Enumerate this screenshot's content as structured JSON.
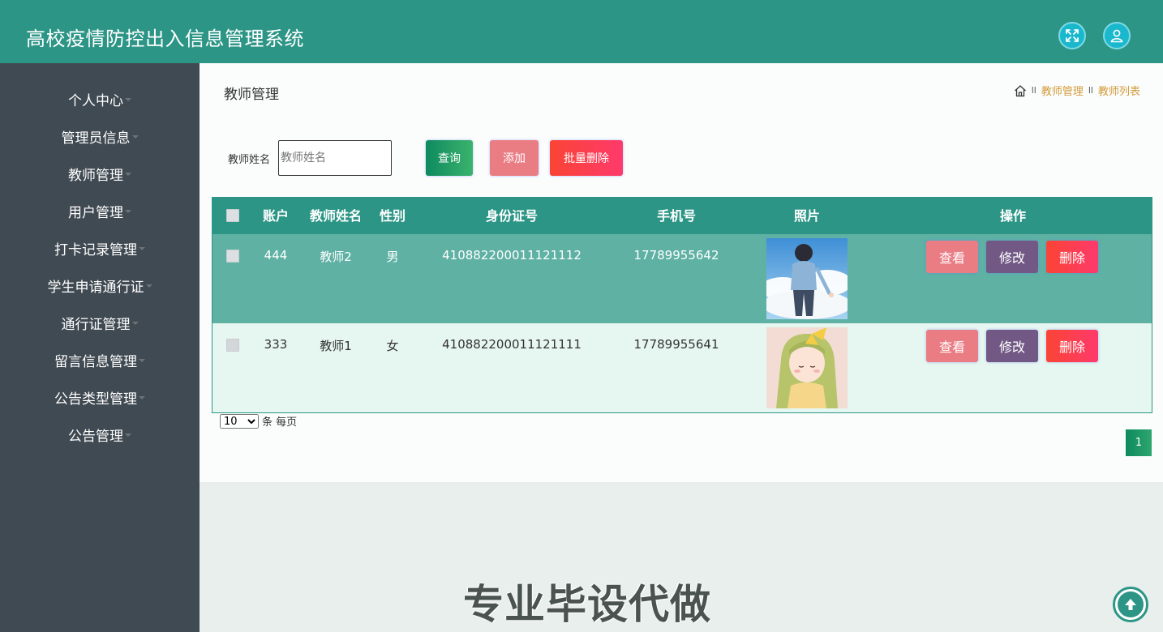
{
  "header": {
    "title": "高校疫情防控出入信息管理系统"
  },
  "sidebar": {
    "items": [
      {
        "label": "个人中心"
      },
      {
        "label": "管理员信息"
      },
      {
        "label": "教师管理"
      },
      {
        "label": "用户管理"
      },
      {
        "label": "打卡记录管理"
      },
      {
        "label": "学生申请通行证"
      },
      {
        "label": "通行证管理"
      },
      {
        "label": "留言信息管理"
      },
      {
        "label": "公告类型管理"
      },
      {
        "label": "公告管理"
      }
    ]
  },
  "main": {
    "page_title": "教师管理",
    "breadcrumb": {
      "sep": "ll",
      "items": [
        "教师管理",
        "教师列表"
      ]
    },
    "search": {
      "label": "教师姓名",
      "placeholder": "教师姓名",
      "value": ""
    },
    "buttons": {
      "query": "查询",
      "add": "添加",
      "batch_delete": "批量删除"
    },
    "table": {
      "columns": [
        "账户",
        "教师姓名",
        "性别",
        "身份证号",
        "手机号",
        "照片",
        "操作"
      ],
      "rows": [
        {
          "account": "444",
          "name": "教师2",
          "gender": "男",
          "id_number": "410882200011121112",
          "phone": "17789955642"
        },
        {
          "account": "333",
          "name": "教师1",
          "gender": "女",
          "id_number": "410882200011121111",
          "phone": "17789955641"
        }
      ],
      "actions": {
        "view": "查看",
        "edit": "修改",
        "delete": "删除"
      }
    },
    "pagination": {
      "page_size": "10",
      "page_size_suffix": "条 每页",
      "current_page": "1"
    }
  },
  "watermark": "专业毕设代做",
  "colors": {
    "primary": "#2c9586",
    "sidebar": "#404a52",
    "row_highlight": "#5fb1a4",
    "row_alt": "#e6f6f0",
    "view_button": "#ea7c84",
    "edit_button": "#725985",
    "delete_button": "#fa4434",
    "breadcrumb_link": "#d39a3a"
  },
  "icons": {
    "fullscreen": "expand-arrows-icon",
    "user": "user-icon",
    "home": "home-icon",
    "back_to_top": "arrow-up-icon"
  }
}
